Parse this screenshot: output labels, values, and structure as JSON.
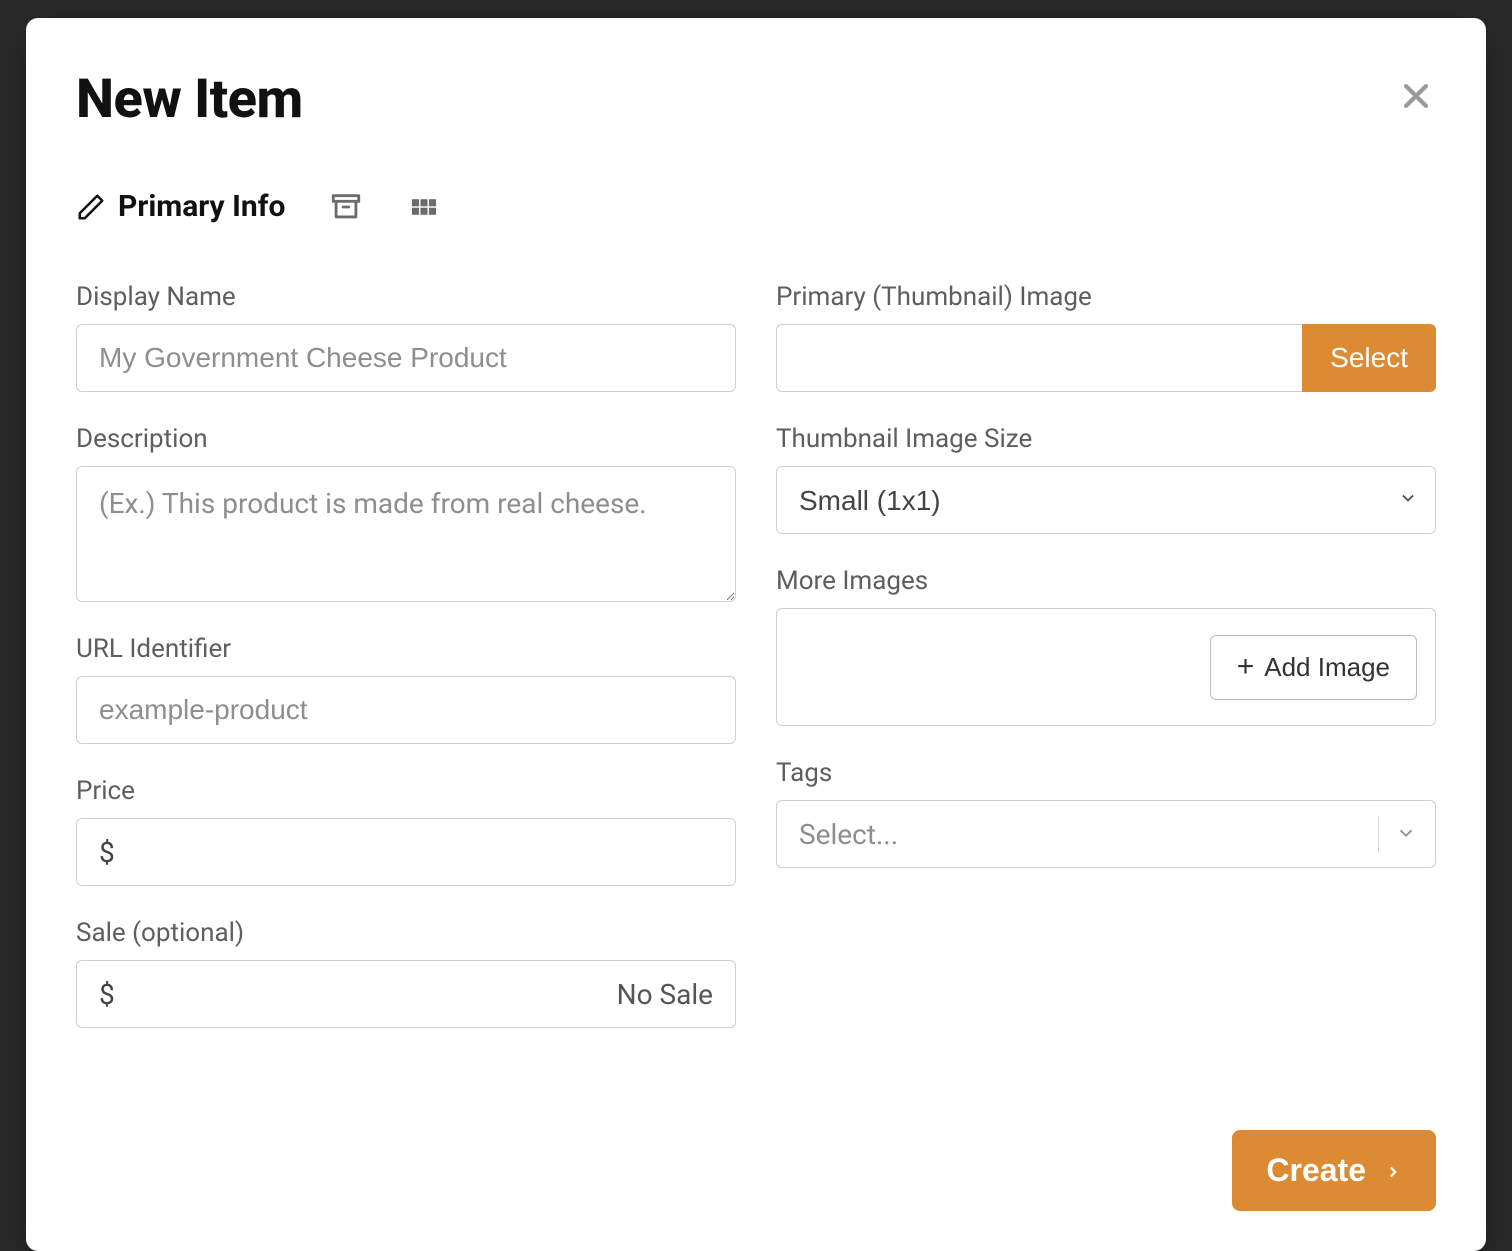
{
  "modal": {
    "title": "New Item",
    "create_label": "Create"
  },
  "tabs": {
    "primary_info": "Primary Info"
  },
  "left": {
    "display_name": {
      "label": "Display Name",
      "placeholder": "My Government Cheese Product",
      "value": ""
    },
    "description": {
      "label": "Description",
      "placeholder": "(Ex.) This product is made from real cheese.",
      "value": ""
    },
    "url_identifier": {
      "label": "URL Identifier",
      "placeholder": "example-product",
      "value": ""
    },
    "price": {
      "label": "Price",
      "prefix": "$",
      "value": ""
    },
    "sale": {
      "label": "Sale (optional)",
      "prefix": "$",
      "suffix": "No Sale",
      "value": ""
    }
  },
  "right": {
    "primary_image": {
      "label": "Primary (Thumbnail) Image",
      "value": "",
      "select_label": "Select"
    },
    "thumb_size": {
      "label": "Thumbnail Image Size",
      "value": "Small (1x1)"
    },
    "more_images": {
      "label": "More Images",
      "add_label": "Add Image"
    },
    "tags": {
      "label": "Tags",
      "placeholder": "Select..."
    }
  }
}
